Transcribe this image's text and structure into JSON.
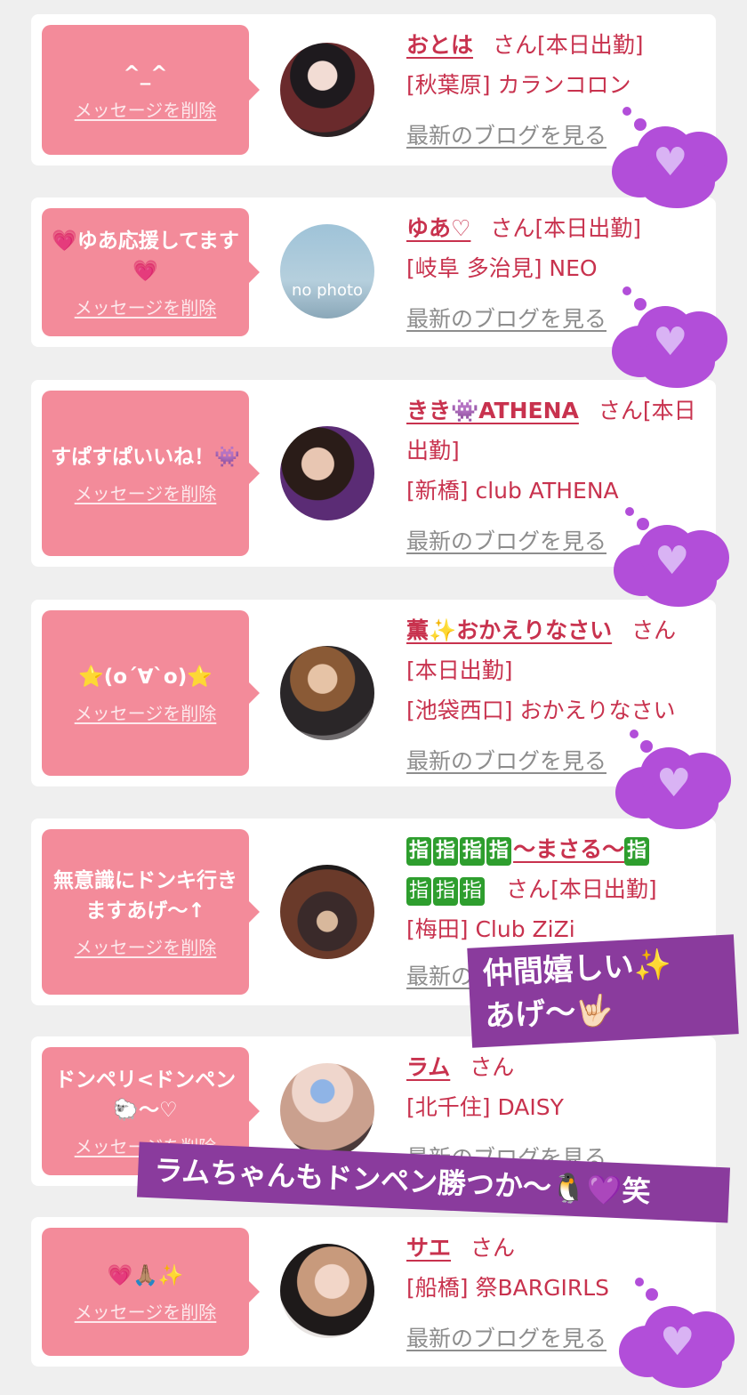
{
  "delete_label": "メッセージを削除",
  "blog_label": "最新のブログを見る",
  "san_label": "さん",
  "cards": [
    {
      "message": "^_^",
      "name": "おとは",
      "status": "[本日出勤]",
      "place": "[秋葉原] カランコロン"
    },
    {
      "message": "💗ゆあ応援してます💗",
      "name": "ゆあ♡",
      "status": "[本日出勤]",
      "place": "[岐阜 多治見] NEO",
      "avatar_text": "no photo"
    },
    {
      "message": "すぱすぱいいね！👾",
      "name": "きき👾ATHENA",
      "status": "[本日出勤]",
      "place": "[新橋] club ATHENA"
    },
    {
      "message": "⭐(o´∀`o)⭐",
      "name": "薫✨おかえりなさい",
      "status": "[本日出勤]",
      "place": "[池袋西口] おかえりなさい"
    },
    {
      "message": "無意識にドンキ行きますあげ〜↑",
      "name_prefix": [
        "指",
        "指",
        "指",
        "指"
      ],
      "name": "〜まさる〜",
      "name_suffix": [
        "指",
        "指",
        "指",
        "指"
      ],
      "status": "[本日出勤]",
      "place": "[梅田] Club ZiZi"
    },
    {
      "message": "ドンペリ<ドンペン🐑〜♡",
      "name": "ラム",
      "status": "",
      "place": "[北千住] DAISY"
    },
    {
      "message": "💗🙏🏽✨",
      "name": "サエ",
      "status": "",
      "place": "[船橋] 祭BARGIRLS"
    }
  ],
  "banner1": {
    "line1": "仲間嬉しい✨",
    "line2": "あげ〜🤟🏻"
  },
  "banner2": {
    "text": "ラムちゃんもドンペン勝つか〜🐧💜笑"
  },
  "colors": {
    "accent": "#c8324e",
    "bubble": "#f38b9a",
    "cloud": "#b24ed9",
    "banner": "#8a3b9d"
  }
}
